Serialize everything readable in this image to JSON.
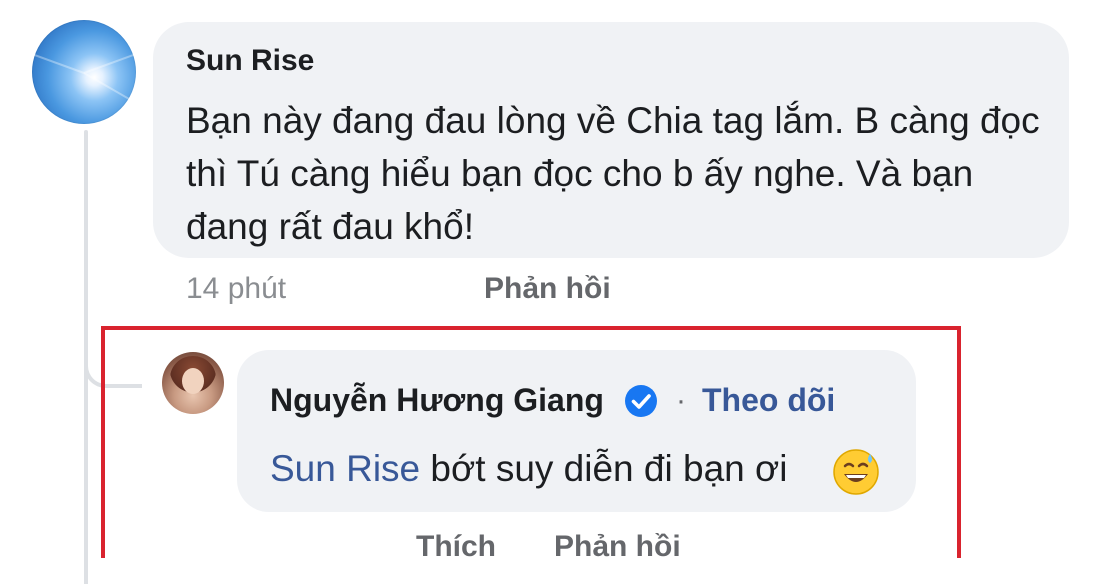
{
  "comment": {
    "author": "Sun Rise",
    "text": "Bạn này đang đau lòng về Chia tag lắm. B càng đọc thì Tú càng hiểu bạn đọc cho b ấy nghe. Và bạn đang rất đau khổ!",
    "time": "14 phút",
    "reply_label": "Phản hồi"
  },
  "reply": {
    "author": "Nguyễn Hương Giang",
    "separator": "·",
    "follow_label": "Theo dõi",
    "mention": "Sun Rise",
    "text": " bớt suy diễn đi bạn ơi",
    "emoji_icon": "grinning-sweat-emoji",
    "like_label": "Thích",
    "reply_label": "Phản hồi"
  },
  "colors": {
    "bubble": "#f0f2f5",
    "link": "#385898",
    "highlight_box": "#d9232e",
    "verified": "#1877f2"
  }
}
